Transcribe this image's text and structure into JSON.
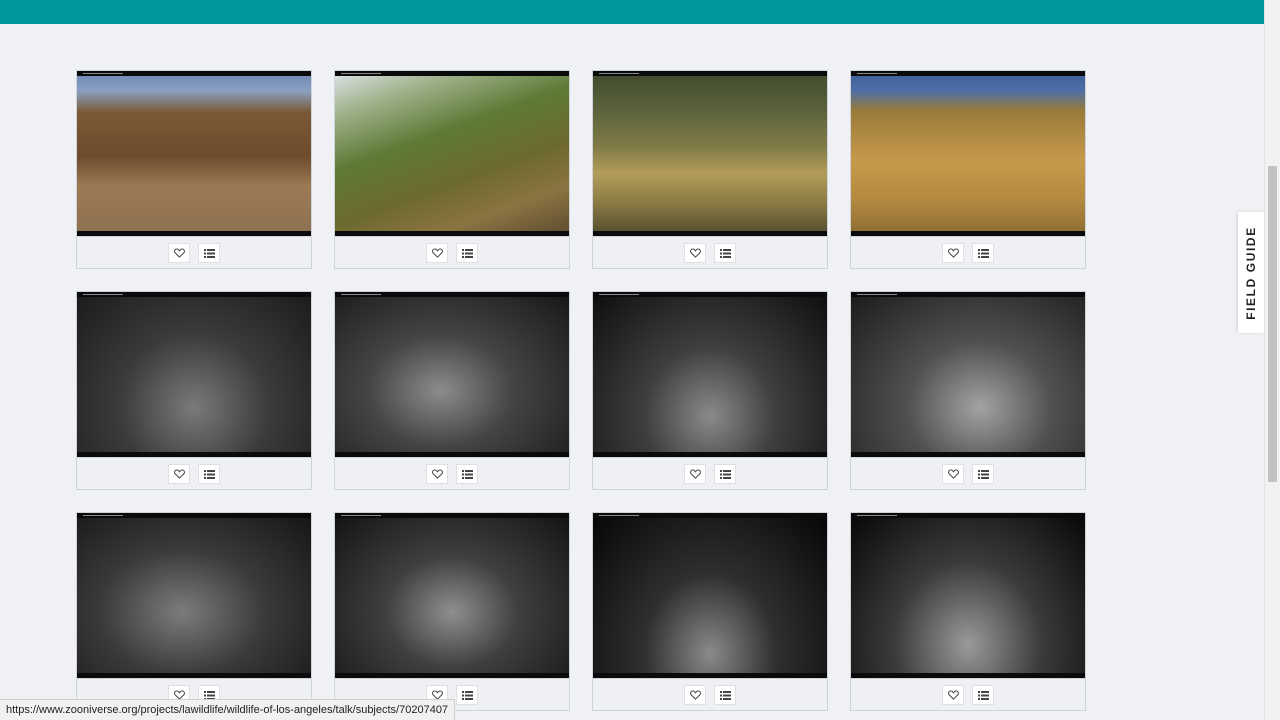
{
  "field_guide": {
    "label": "FIELD GUIDE"
  },
  "status_bar": {
    "url": "https://www.zooniverse.org/projects/lawildlife/wildlife-of-los-angeles/talk/subjects/70207407"
  },
  "colors": {
    "header": "#00979d",
    "page_background": "#eff1f4"
  },
  "subjects": [
    {
      "scene": "day1",
      "favorite_icon": "heart-outline-icon",
      "collect_icon": "list-icon"
    },
    {
      "scene": "day2",
      "favorite_icon": "heart-outline-icon",
      "collect_icon": "list-icon"
    },
    {
      "scene": "day3",
      "favorite_icon": "heart-outline-icon",
      "collect_icon": "list-icon"
    },
    {
      "scene": "day4",
      "favorite_icon": "heart-outline-icon",
      "collect_icon": "list-icon"
    },
    {
      "scene": "night1",
      "favorite_icon": "heart-outline-icon",
      "collect_icon": "list-icon"
    },
    {
      "scene": "night2",
      "favorite_icon": "heart-outline-icon",
      "collect_icon": "list-icon"
    },
    {
      "scene": "night3",
      "favorite_icon": "heart-outline-icon",
      "collect_icon": "list-icon"
    },
    {
      "scene": "night4",
      "favorite_icon": "heart-outline-icon",
      "collect_icon": "list-icon"
    },
    {
      "scene": "night5",
      "favorite_icon": "heart-outline-icon",
      "collect_icon": "list-icon"
    },
    {
      "scene": "night6",
      "favorite_icon": "heart-outline-icon",
      "collect_icon": "list-icon"
    },
    {
      "scene": "night7",
      "favorite_icon": "heart-outline-icon",
      "collect_icon": "list-icon"
    },
    {
      "scene": "night8",
      "favorite_icon": "heart-outline-icon",
      "collect_icon": "list-icon"
    }
  ]
}
